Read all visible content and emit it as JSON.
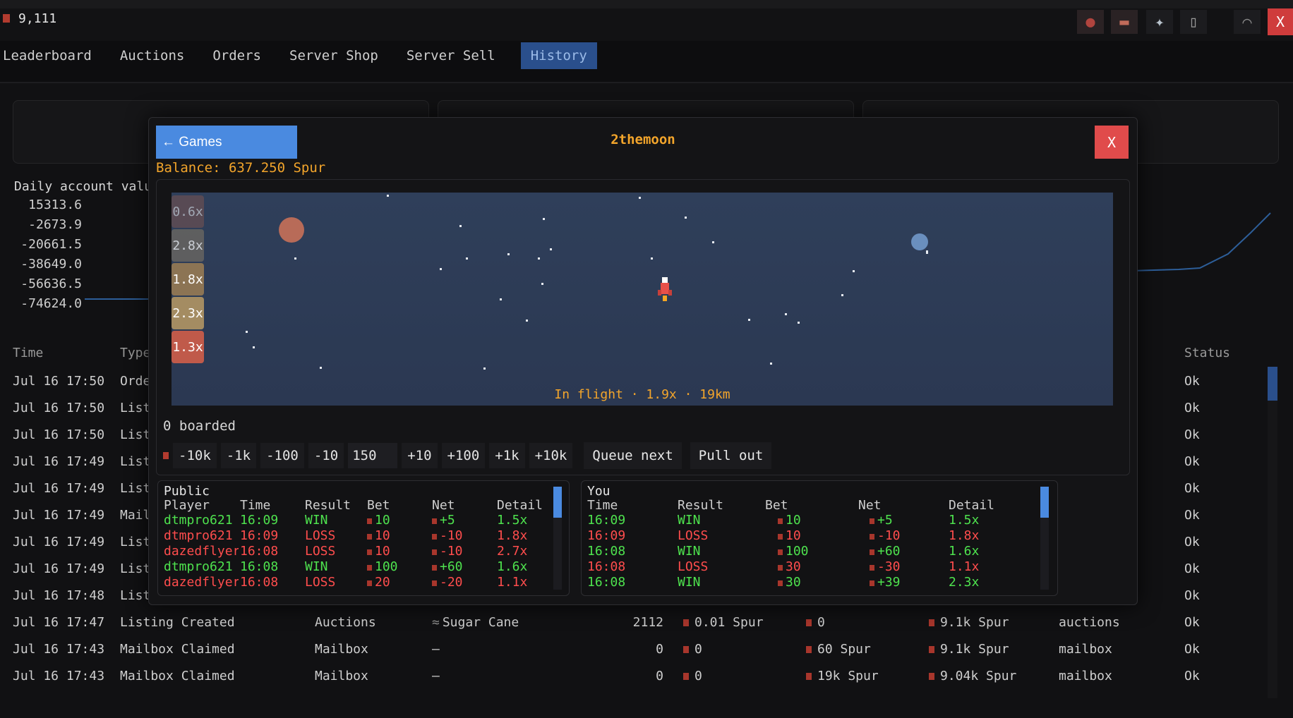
{
  "topbar": {
    "balance": "9,111",
    "icons": [
      "fish-icon",
      "brick-icon",
      "compass-icon",
      "jar-icon",
      "boot-icon"
    ],
    "close_label": "X"
  },
  "tabs": [
    "Leaderboard",
    "Auctions",
    "Orders",
    "Server Shop",
    "Server Sell",
    "History"
  ],
  "active_tab": "History",
  "background": {
    "chart_title": "Daily account value",
    "y_ticks": [
      "15313.6",
      "-2673.9",
      "-20661.5",
      "-38649.0",
      "-56636.5",
      "-74624.0"
    ],
    "table_headers": {
      "time": "Time",
      "type": "Type",
      "status": "Status"
    },
    "rows_partial": [
      {
        "time": "Jul 16 17:50",
        "type": "Orde",
        "status": "Ok"
      },
      {
        "time": "Jul 16 17:50",
        "type": "Listi",
        "status": "Ok"
      },
      {
        "time": "Jul 16 17:50",
        "type": "Listi",
        "status": "Ok"
      },
      {
        "time": "Jul 16 17:49",
        "type": "Listi",
        "status": "Ok"
      },
      {
        "time": "Jul 16 17:49",
        "type": "Listi",
        "status": "Ok"
      },
      {
        "time": "Jul 16 17:49",
        "type": "Mailb",
        "status": "Ok"
      },
      {
        "time": "Jul 16 17:49",
        "type": "Listi",
        "status": "Ok"
      },
      {
        "time": "Jul 16 17:49",
        "type": "Listi",
        "status": "Ok"
      },
      {
        "time": "Jul 16 17:48",
        "type": "Listi",
        "status": "Ok"
      }
    ],
    "rows_full": [
      {
        "time": "Jul 16 17:47",
        "type": "Listing Created",
        "source": "Auctions",
        "item": "Sugar Cane",
        "qty": "2112",
        "price": "0.01 Spur",
        "amount": "0",
        "balance": "9.1k Spur",
        "ref": "auctions",
        "status": "Ok"
      },
      {
        "time": "Jul 16 17:43",
        "type": "Mailbox Claimed",
        "source": "Mailbox",
        "item": "—",
        "qty": "0",
        "price": "0",
        "amount": "60 Spur",
        "balance": "9.1k Spur",
        "ref": "mailbox",
        "status": "Ok"
      },
      {
        "time": "Jul 16 17:43",
        "type": "Mailbox Claimed",
        "source": "Mailbox",
        "item": "—",
        "qty": "0",
        "price": "0",
        "amount": "19k Spur",
        "balance": "9.04k Spur",
        "ref": "mailbox",
        "status": "Ok"
      }
    ]
  },
  "modal": {
    "back_label": "← Games",
    "title": "2themoon",
    "close_label": "X",
    "balance": "Balance: 637.250 Spur",
    "multipliers": [
      {
        "label": "0.6x",
        "color": "#7a5450"
      },
      {
        "label": "2.8x",
        "color": "#6f6a62"
      },
      {
        "label": "1.8x",
        "color": "#8c7454"
      },
      {
        "label": "2.3x",
        "color": "#a48c62"
      },
      {
        "label": "1.3x",
        "color": "#c05a4a"
      }
    ],
    "flight_status": "In flight · 1.9x · 19km",
    "boarded": "0 boarded",
    "bet_buttons_minus": [
      "-10k",
      "-1k",
      "-100",
      "-10"
    ],
    "bet_value": "150",
    "bet_buttons_plus": [
      "+10",
      "+100",
      "+1k",
      "+10k"
    ],
    "queue_label": "Queue next",
    "pullout_label": "Pull out",
    "public": {
      "title": "Public",
      "headers": [
        "Player",
        "Time",
        "Result",
        "Bet",
        "Net",
        "Detail"
      ],
      "rows": [
        {
          "player": "dtmpro621",
          "time": "16:09",
          "result": "WIN",
          "bet": "10",
          "net": "+5",
          "detail": "1.5x"
        },
        {
          "player": "dtmpro621",
          "time": "16:09",
          "result": "LOSS",
          "bet": "10",
          "net": "-10",
          "detail": "1.8x"
        },
        {
          "player": "dazedflyer",
          "time": "16:08",
          "result": "LOSS",
          "bet": "10",
          "net": "-10",
          "detail": "2.7x"
        },
        {
          "player": "dtmpro621",
          "time": "16:08",
          "result": "WIN",
          "bet": "100",
          "net": "+60",
          "detail": "1.6x"
        },
        {
          "player": "dazedflyer",
          "time": "16:08",
          "result": "LOSS",
          "bet": "20",
          "net": "-20",
          "detail": "1.1x"
        }
      ]
    },
    "you": {
      "title": "You",
      "headers": [
        "Time",
        "Result",
        "Bet",
        "Net",
        "Detail"
      ],
      "rows": [
        {
          "time": "16:09",
          "result": "WIN",
          "bet": "10",
          "net": "+5",
          "detail": "1.5x"
        },
        {
          "time": "16:09",
          "result": "LOSS",
          "bet": "10",
          "net": "-10",
          "detail": "1.8x"
        },
        {
          "time": "16:08",
          "result": "WIN",
          "bet": "100",
          "net": "+60",
          "detail": "1.6x"
        },
        {
          "time": "16:08",
          "result": "LOSS",
          "bet": "30",
          "net": "-30",
          "detail": "1.1x"
        },
        {
          "time": "16:08",
          "result": "WIN",
          "bet": "30",
          "net": "+39",
          "detail": "2.3x"
        }
      ]
    }
  }
}
